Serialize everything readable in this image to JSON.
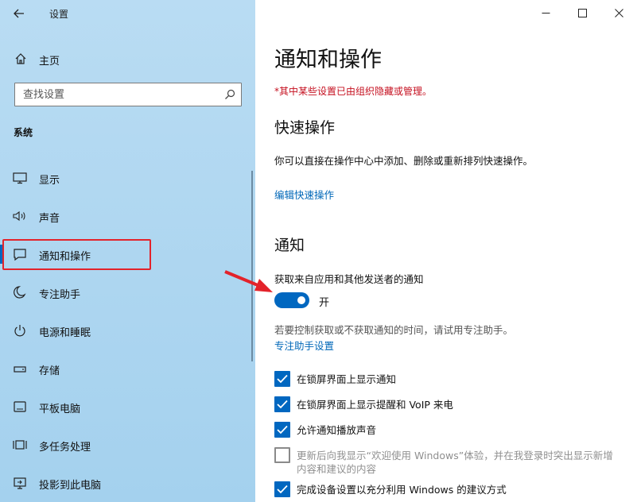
{
  "window": {
    "app_title": "设置",
    "minimize": "—",
    "maximize": "☐",
    "close": "✕"
  },
  "sidebar": {
    "home_label": "主页",
    "search_placeholder": "查找设置",
    "section": "系统",
    "items": [
      {
        "label": "显示",
        "icon": "monitor-icon"
      },
      {
        "label": "声音",
        "icon": "speaker-icon"
      },
      {
        "label": "通知和操作",
        "icon": "notification-icon",
        "selected": true
      },
      {
        "label": "专注助手",
        "icon": "moon-icon"
      },
      {
        "label": "电源和睡眠",
        "icon": "power-icon"
      },
      {
        "label": "存储",
        "icon": "storage-icon"
      },
      {
        "label": "平板电脑",
        "icon": "tablet-icon"
      },
      {
        "label": "多任务处理",
        "icon": "multitask-icon"
      },
      {
        "label": "投影到此电脑",
        "icon": "project-icon"
      }
    ]
  },
  "main": {
    "title": "通知和操作",
    "managed_note": "*其中某些设置已由组织隐藏或管理。",
    "quick_actions": {
      "heading": "快速操作",
      "description": "你可以直接在操作中心中添加、删除或重新排列快速操作。",
      "edit_link": "编辑快速操作"
    },
    "notifications": {
      "heading": "通知",
      "toggle_label": "获取来自应用和其他发送者的通知",
      "toggle_state": "开",
      "toggle_on": true,
      "hint": "若要控制获取或不获取通知的时间，请试用专注助手。",
      "focus_link": "专注助手设置",
      "checkboxes": [
        {
          "label": "在锁屏界面上显示通知",
          "checked": true,
          "enabled": true
        },
        {
          "label": "在锁屏界面上显示提醒和 VoIP 来电",
          "checked": true,
          "enabled": true
        },
        {
          "label": "允许通知播放声音",
          "checked": true,
          "enabled": true
        },
        {
          "label": "更新后向我显示“欢迎使用 Windows”体验，并在我登录时突出显示新增内容和建议的内容",
          "checked": false,
          "enabled": false
        },
        {
          "label": "完成设备设置以充分利用 Windows 的建议方式",
          "checked": true,
          "enabled": true
        }
      ]
    }
  },
  "colors": {
    "accent": "#0067c0",
    "warning": "#c50f1f",
    "highlight": "#e3232b"
  }
}
